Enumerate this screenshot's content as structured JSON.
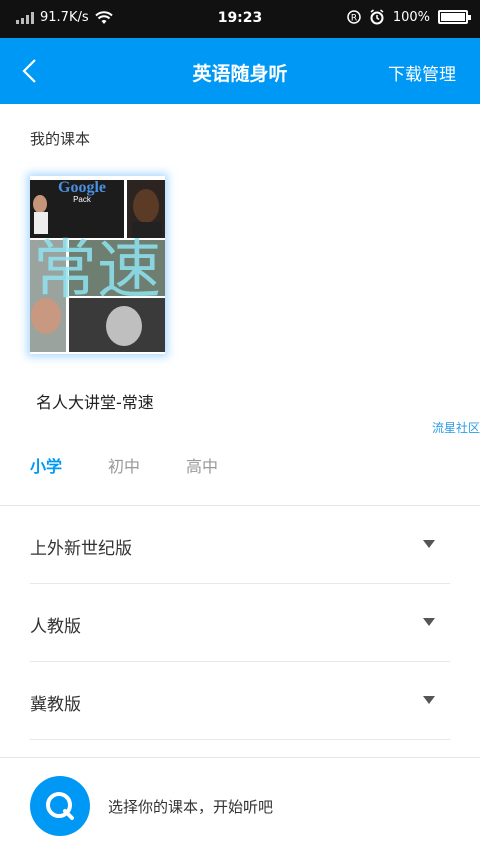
{
  "status": {
    "network_speed": "91.7K/s",
    "time": "19:23",
    "battery": "100%",
    "battery_level": 1.0
  },
  "nav": {
    "title": "英语随身听",
    "right_action": "下载管理"
  },
  "my_books": {
    "label": "我的课本",
    "book_name": "名人大讲堂-常速",
    "cover_overlay": "常速",
    "cover_brand": "Google",
    "cover_sub": "Pack"
  },
  "watermark": "流星社区",
  "tabs": [
    "小学",
    "初中",
    "高中"
  ],
  "active_tab": 0,
  "editions": [
    "上外新世纪版",
    "人教版",
    "冀教版"
  ],
  "footer": {
    "hint": "选择你的课本，开始听吧"
  },
  "colors": {
    "accent": "#0098f5",
    "status_bar": "#111111"
  }
}
